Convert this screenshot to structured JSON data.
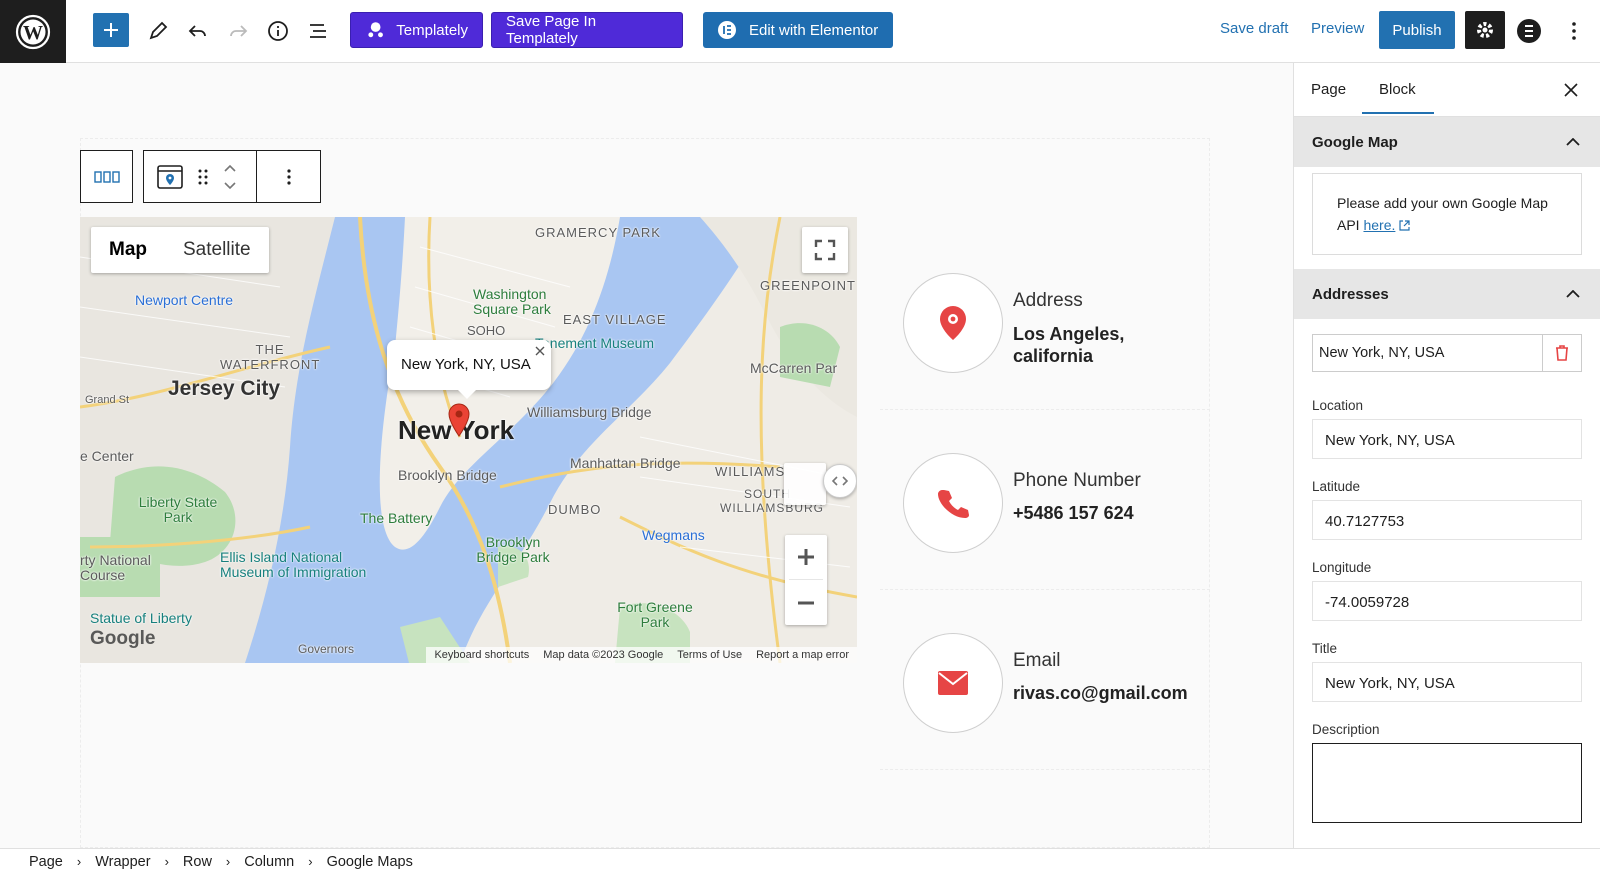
{
  "toolbar": {
    "templately_label": "Templately",
    "save_templately_label": "Save Page In Templately",
    "elementor_label": "Edit with Elementor",
    "save_draft_label": "Save draft",
    "preview_label": "Preview",
    "publish_label": "Publish"
  },
  "map": {
    "map_tab": "Map",
    "satellite_tab": "Satellite",
    "info_window": "New York, NY, USA",
    "labels": {
      "gramercy": "GRAMERCY PARK",
      "greenpoint": "GREENPOINT",
      "newport": "Newport Centre",
      "washington": "Washington Square Park",
      "soho": "SOHO",
      "east_village": "EAST VILLAGE",
      "tenement": "Tenement Museum",
      "the_waterfront": "THE WATERFRONT",
      "jersey_city": "Jersey City",
      "mccarren": "McCarren Par",
      "williamsburg_bridge": "Williamsburg Bridge",
      "new_york": "New York",
      "grand_st": "Grand St",
      "center": "e Center",
      "brooklyn_bridge": "Brooklyn Bridge",
      "manhattan_bridge": "Manhattan Bridge",
      "williams": "WILLIAMS",
      "south_williamsburg": "SOUTH WILLIAMSBURG",
      "liberty_park": "Liberty State Park",
      "the_battery": "The Battery",
      "dumbo": "DUMBO",
      "wegmans": "Wegmans",
      "ellis": "Ellis Island National Museum of Immigration",
      "national_course": "rty National Course",
      "brooklyn_bridge_park": "Brooklyn Bridge Park",
      "statue": "Statue of Liberty",
      "fort_greene": "Fort Greene Park",
      "google": "Google",
      "governors": "Governors"
    },
    "footer": {
      "shortcuts": "Keyboard shortcuts",
      "map_data": "Map data ©2023 Google",
      "terms": "Terms of Use",
      "report": "Report a map error"
    }
  },
  "contacts": [
    {
      "label": "Address",
      "value": "Los Angeles, california"
    },
    {
      "label": "Phone Number",
      "value": "+5486 157 624"
    },
    {
      "label": "Email",
      "value": "rivas.co@gmail.com"
    }
  ],
  "sidebar": {
    "tab_page": "Page",
    "tab_block": "Block",
    "google_map_panel": "Google Map",
    "notice_text": "Please add your own Google Map API ",
    "notice_link": "here.",
    "addresses_panel": "Addresses",
    "address_item": "New York, NY, USA",
    "location_label": "Location",
    "location_value": "New York, NY, USA",
    "latitude_label": "Latitude",
    "latitude_value": "40.7127753",
    "longitude_label": "Longitude",
    "longitude_value": "-74.0059728",
    "title_label": "Title",
    "title_value": "New York, NY, USA",
    "description_label": "Description"
  },
  "breadcrumb": [
    "Page",
    "Wrapper",
    "Row",
    "Column",
    "Google Maps"
  ],
  "colors": {
    "wp_blue": "#2271b1",
    "templately_purple": "#4f2ad8",
    "icon_red": "#e64545",
    "water": "#a9c6f2"
  }
}
